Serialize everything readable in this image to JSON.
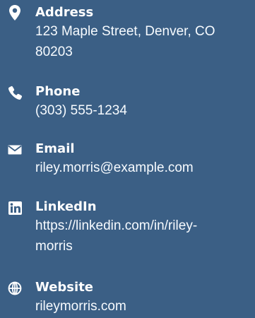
{
  "contact": {
    "items": [
      {
        "label": "Address",
        "value_line1": "123 Maple Street, Denver, CO",
        "value_line2": "80203",
        "icon": "map-marker-icon"
      },
      {
        "label": "Phone",
        "value": "(303) 555-1234",
        "icon": "phone-icon"
      },
      {
        "label": "Email",
        "value": "riley.morris@example.com",
        "icon": "envelope-icon"
      },
      {
        "label": "LinkedIn",
        "value_line1": "https://linkedin.com/in/riley-",
        "value_line2": "morris",
        "icon": "linkedin-icon"
      },
      {
        "label": "Website",
        "value": "rileymorris.com",
        "icon": "globe-icon"
      }
    ]
  },
  "colors": {
    "background": "#3b5f85",
    "text": "#ffffff"
  }
}
